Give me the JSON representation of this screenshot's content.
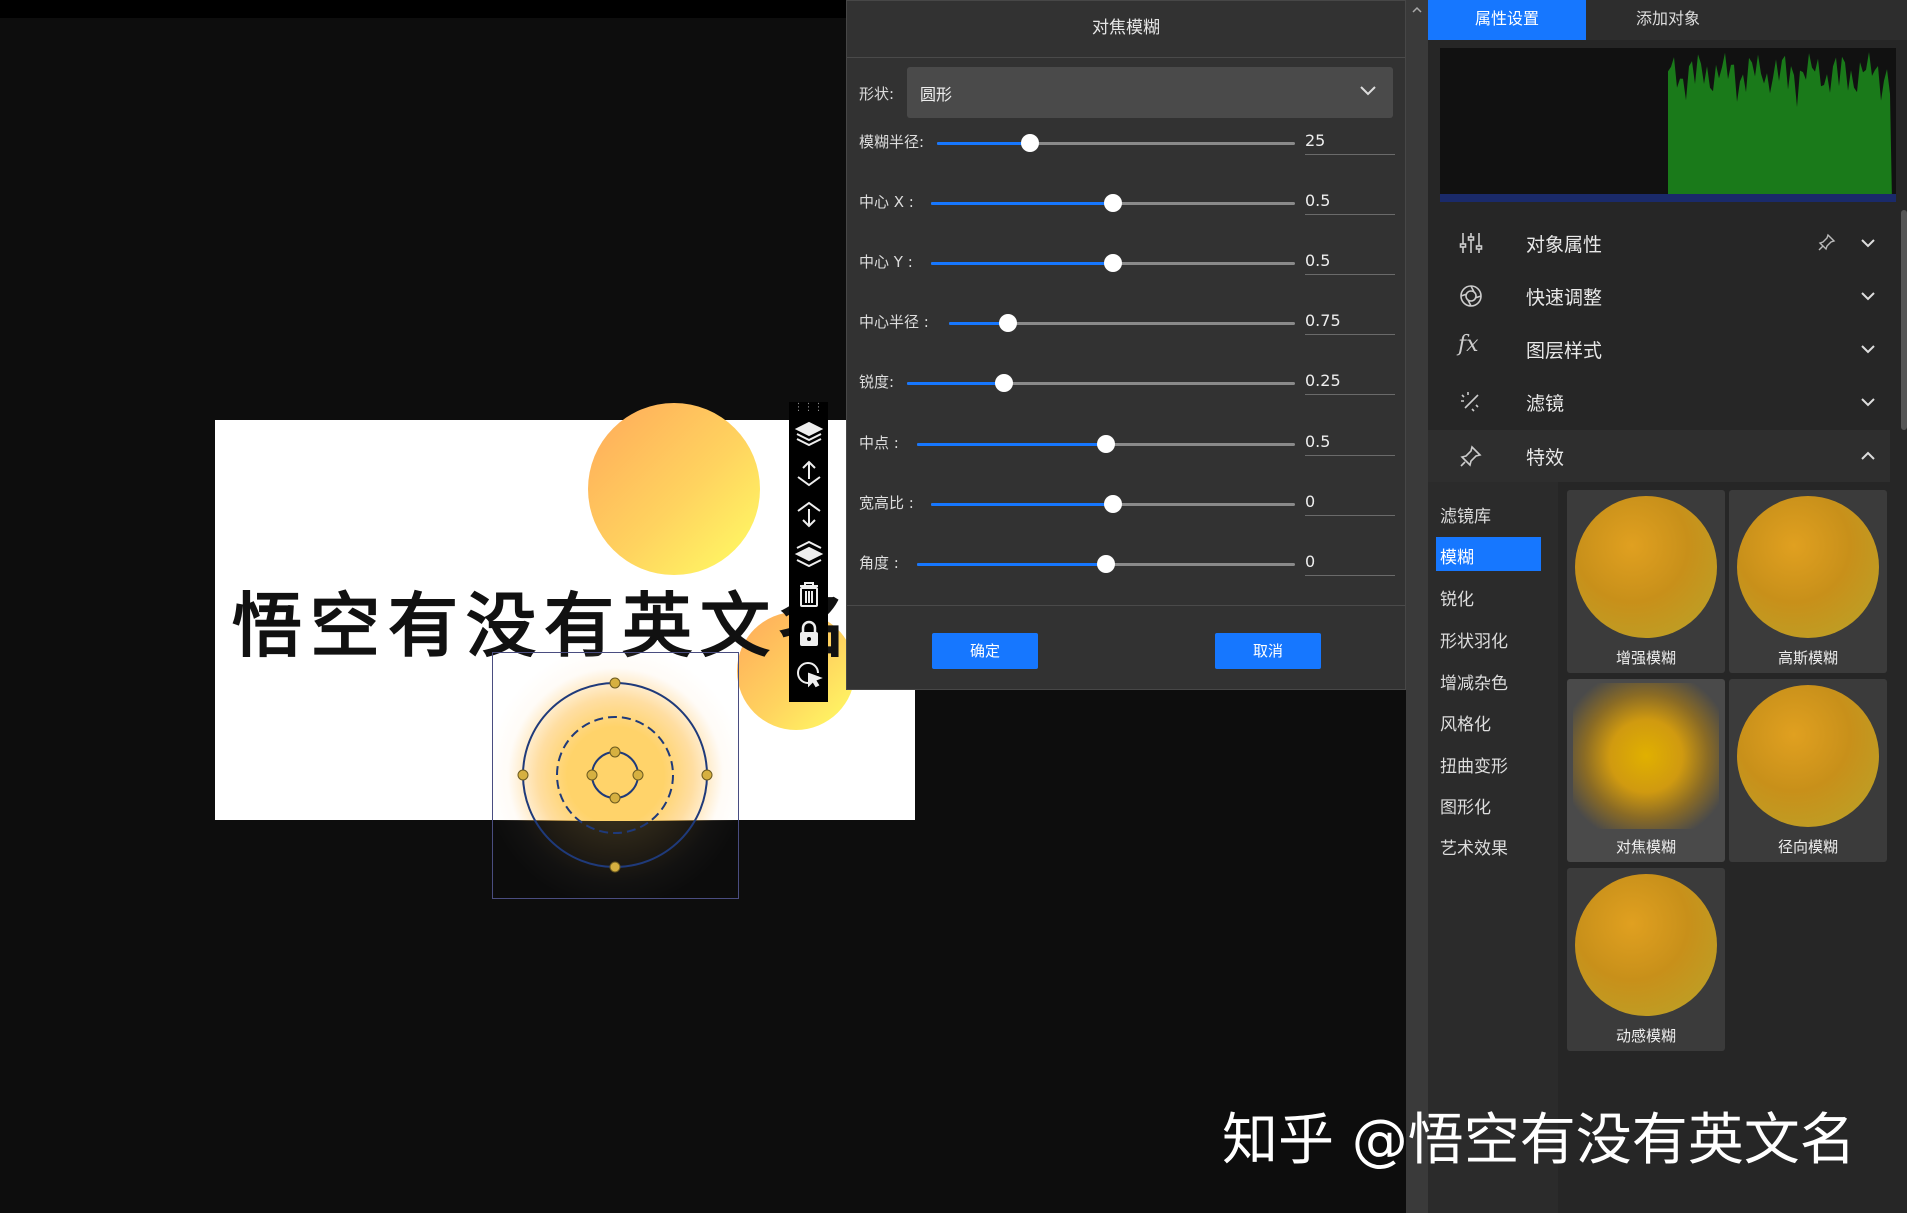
{
  "dialog": {
    "title": "对焦模糊",
    "shape_label": "形状:",
    "shape_value": "圆形",
    "sliders": [
      {
        "label": "模糊半径:",
        "value_text": "25",
        "fraction": 0.26
      },
      {
        "label": "中心 X :",
        "value_text": "0.5",
        "fraction": 0.5
      },
      {
        "label": "中心 Y :",
        "value_text": "0.5",
        "fraction": 0.5
      },
      {
        "label": "中心半径 :",
        "value_text": "0.75",
        "fraction": 0.17
      },
      {
        "label": "锐度:",
        "value_text": "0.25",
        "fraction": 0.25
      },
      {
        "label": "中点 :",
        "value_text": "0.5",
        "fraction": 0.5
      },
      {
        "label": "宽高比 :",
        "value_text": "0",
        "fraction": 0.5
      },
      {
        "label": "角度 :",
        "value_text": "0",
        "fraction": 0.5
      }
    ],
    "confirm_label": "确定",
    "cancel_label": "取消"
  },
  "canvas": {
    "title_text": "悟空有没有英文名"
  },
  "right_panel": {
    "tabs": [
      "属性设置",
      "添加对象"
    ],
    "sections": [
      {
        "label": "对象属性",
        "icon": "sliders-icon",
        "expanded": false
      },
      {
        "label": "快速调整",
        "icon": "aperture-icon",
        "expanded": false
      },
      {
        "label": "图层样式",
        "icon": "fx-icon",
        "expanded": false
      },
      {
        "label": "滤镜",
        "icon": "magic-wand-icon",
        "expanded": false
      },
      {
        "label": "特效",
        "icon": "pin-wand-icon",
        "expanded": true
      }
    ],
    "fx_text": "fx",
    "categories": [
      "滤镜库",
      "模糊",
      "锐化",
      "形状羽化",
      "增减杂色",
      "风格化",
      "扭曲变形",
      "图形化",
      "艺术效果"
    ],
    "active_category": "模糊",
    "effects": [
      "增强模糊",
      "高斯模糊",
      "对焦模糊",
      "径向模糊",
      "动感模糊"
    ],
    "selected_effect": "对焦模糊"
  },
  "colors": {
    "accent": "#1677ff",
    "dialog_bg": "#323232",
    "panel_bg": "#262626"
  },
  "watermark": "知乎 @悟空有没有英文名"
}
